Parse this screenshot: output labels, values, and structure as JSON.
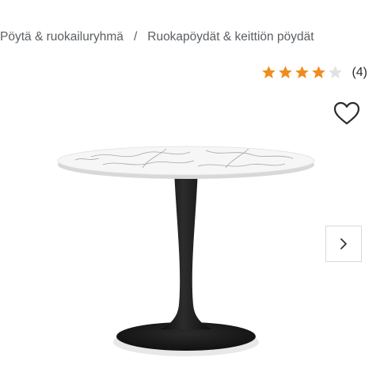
{
  "breadcrumb": {
    "items": [
      {
        "label": "Pöytä & ruokailuryhmä"
      },
      {
        "label": "Ruokapöydät & keittiön pöydät"
      }
    ],
    "separator": "/"
  },
  "rating": {
    "stars_filled": 4,
    "stars_total": 5,
    "count_label": "(4)",
    "star_color": "#f08c1e",
    "empty_star_color": "#e2e2e2"
  },
  "actions": {
    "favorite_icon": "heart-outline-icon",
    "next_icon": "chevron-right-icon"
  },
  "product_image": {
    "subject": "round white marble-top table with black pedestal base"
  }
}
